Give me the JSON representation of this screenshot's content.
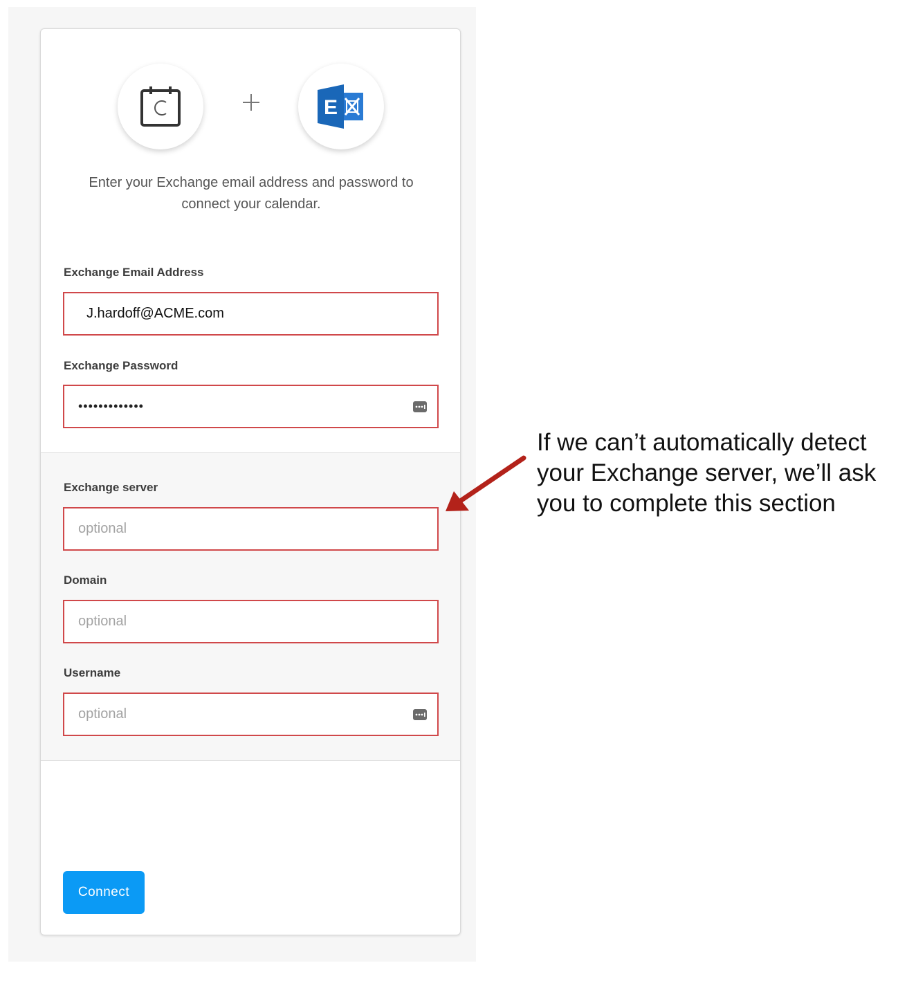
{
  "intro_text": "Enter your Exchange email address and password to connect your calendar.",
  "logos": {
    "left_icon": "calendar-c-icon",
    "plus": "+",
    "right_icon": "microsoft-exchange-icon",
    "exchange_letter": "E"
  },
  "fields": {
    "email": {
      "label": "Exchange Email Address",
      "value": "J.hardoff@ACME.com"
    },
    "password": {
      "label": "Exchange Password",
      "value": "•••••••••••••"
    },
    "server": {
      "label": "Exchange server",
      "placeholder": "optional"
    },
    "domain": {
      "label": "Domain",
      "placeholder": "optional"
    },
    "username": {
      "label": "Username",
      "placeholder": "optional"
    }
  },
  "connect_label": "Connect",
  "annotation": {
    "line1": "If we can’t automatically detect",
    "line2": "your Exchange server, we’ll ask",
    "line3": "you to complete this section"
  },
  "colors": {
    "field_border": "#d0484a",
    "button": "#0b9af5",
    "arrow": "#b3221a",
    "exchange_blue": "#1a67b8"
  }
}
